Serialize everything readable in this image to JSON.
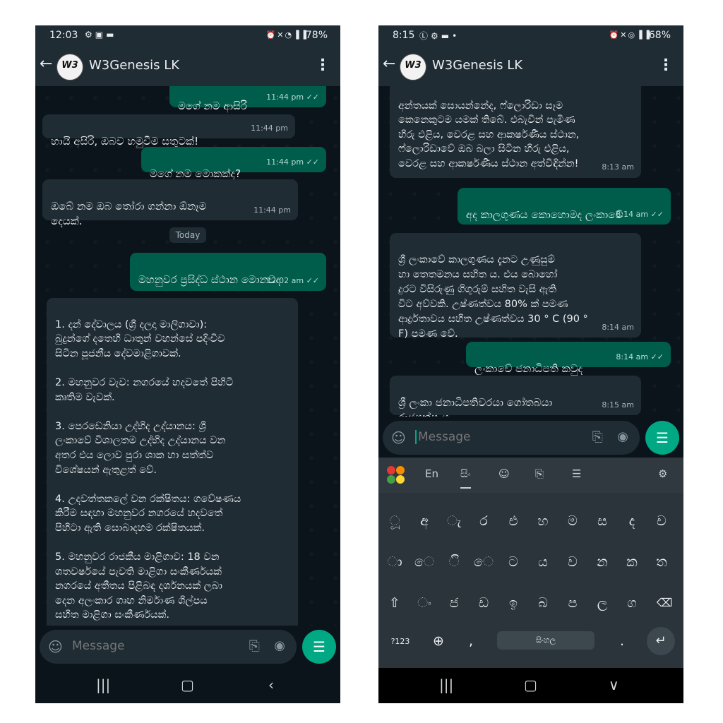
{
  "left": {
    "status": {
      "time": "12:03",
      "battery": "78%"
    },
    "header": {
      "avatar_text": "W3",
      "title": "W3Genesis LK"
    },
    "messages": [
      {
        "text": "මගේ නම ආසිරි",
        "time": "11:44 pm"
      },
      {
        "text": "හායි අසිරි, ඔබව හමුවීම සතුටක්!",
        "time": "11:44 pm"
      },
      {
        "text": "මගේ නම මොකක්ද?",
        "time": "11:44 pm"
      },
      {
        "text": "ඔබේ නම ඔබ තෝරා ගන්නා ඕනෑම\nදෙයක්.",
        "time": "11:44 pm"
      },
      {
        "text": "මහනුවර ප්‍රසිද්ධ ස්ථාන මොනවද",
        "time": "12:02 am"
      },
      {
        "text": "1. දන් දේවාලය (ශ්‍රී දලදා මාලිගාවා):\nබුදුන්ගේ දතෙහි ධාතුන් වහන්සේ පදිංචිව\nසිටින පූජනීය දේවමාළිගාවක්.\n\n2. මහනුවර වැව: නගරයේ හදවතේ පිහිටි\nකෘතිම වැවක්.\n\n3. පෙරඩෙනියා උද්භිද උද්යානය: ශ්‍රී\nලංකාවේ විශාලතම උද්භිද උද්යානය වන\nඅතර එය ලොව පුරා ශාක හා සත්ත්ව\nවිශේෂයන් ඇතුළත් වේ.\n\n4. උදවත්තකලේ වන රක්ෂිතය: ගවේෂණය\nකිරීම සඳහා මහනුවර නගරයේ හදවතේ\nපිහිටා ඇති සොබාදහම රක්ෂිතයක්.\n\n5. මහනුවර රාජකීය මාළිගාව: 18 වන\nශතවර්ෂයේ පැවති මාළිගා සංකීර්ණයක්\nනගරයේ අතීතය පිළිබඳ දර්ශනයක් ලබා\nදෙන අලංකාර ගෘහ නිර්මාණ ශිල්පය\nසහිත මාළිගා සංකීර්ණයක්.",
        "time": ""
      }
    ],
    "date_chip": "Today",
    "composer": {
      "placeholder": "Message"
    }
  },
  "right": {
    "status": {
      "time": "8:15",
      "battery": "68%"
    },
    "header": {
      "avatar_text": "W3",
      "title": "W3Genesis LK"
    },
    "messages": [
      {
        "text": "අන්තයක් සොයන්නේද, ෆ්ලොරිඩා සෑම\nකෙනෙකුටම යමක් තිබේ. එබැවින් පැමිණ\nහිරු එළිය, වෙරළ සහ ආකර්ෂණීය ස්ථාන,\nෆ්ලොරිඩාවේ ඔබ බලා සිටින හිරු එළිය,\nවෙරළ සහ ආකර්ෂණීය ස්ථාන අත්විඳින්න!",
        "time": "8:13 am"
      },
      {
        "text": "අද කාලගුණය කොහොමද ලංකාවේ",
        "time": "8:14 am"
      },
      {
        "text": "ශ්‍රී ලංකාවේ කාලගුණය දැනට උණුසුම්\nහා තෙතමනය සහිත ය. එය බොහෝ\nදුරට විසිරුණු ගිගුරුම් සහිත වැසි ඇති\nවිට අව්වකි. උෂ්ණත්වය 80% ක් පමණ\nආර්ද්‍රතාවය සහිත උෂ්ණත්වය 30 ° C (90 °\nF) පමණ වේ.",
        "time": "8:14 am"
      },
      {
        "text": "ලංකාවේ ජනාධිපති කවුද",
        "time": "8:14 am"
      },
      {
        "text": "ශ්‍රී ලංකා ජනාධිපතිවරයා ගෝතබයා\nරාජපක්ෂ ය.",
        "time": "8:15 am"
      }
    ],
    "composer": {
      "placeholder": "Message"
    },
    "keyboard": {
      "lang_en": "En",
      "lang_si": "සිං",
      "row1": [
        "ූ",
        "අ",
        "ැ",
        "ර",
        "එ",
        "හ",
        "ම",
        "ස",
        "ද",
        "ච"
      ],
      "row2": [
        "ා",
        "ෙ",
        "ි",
        "ෙ",
        "ට",
        "ය",
        "ව",
        "න",
        "ක",
        "ත"
      ],
      "row3": [
        "ං",
        "ජ",
        "ඩ",
        "ඉ",
        "බ",
        "ප",
        "ල",
        "ග"
      ],
      "numkey": "?123",
      "comma": ",",
      "space": "සිංහල",
      "period": "."
    }
  }
}
